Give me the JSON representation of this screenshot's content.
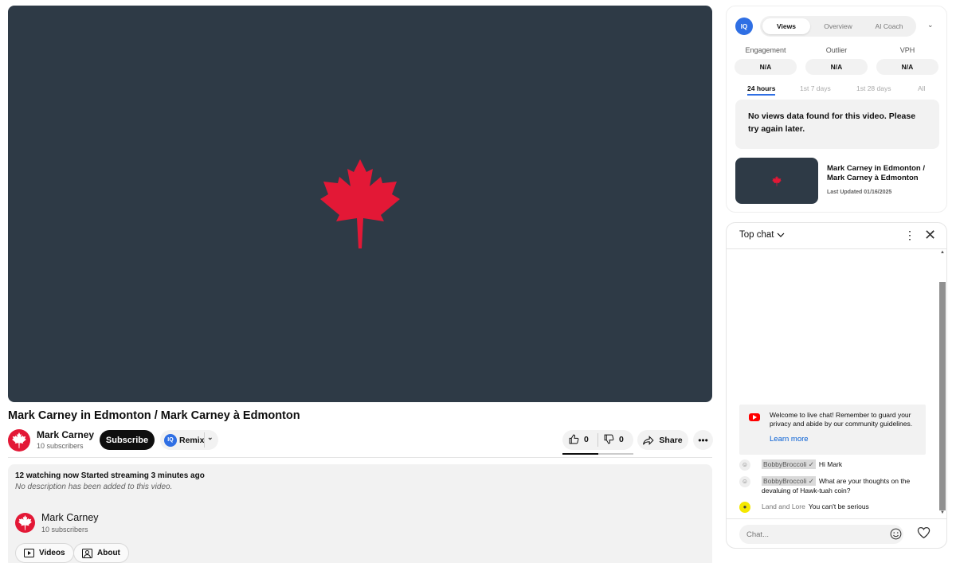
{
  "video": {
    "title": "Mark Carney in Edmonton / Mark Carney à Edmonton",
    "player_bg": "#2e3a46",
    "leaf_color": "#e31836"
  },
  "channel": {
    "name": "Mark Carney",
    "subscribers": "10 subscribers"
  },
  "actions": {
    "subscribe": "Subscribe",
    "remix": "Remix",
    "likes": "0",
    "dislikes": "0",
    "share": "Share"
  },
  "description": {
    "meta": "12 watching now  Started streaming 3 minutes ago",
    "empty": "No description has been added to this video.",
    "channel_name": "Mark Carney",
    "channel_subs": "10 subscribers",
    "videos_button": "Videos",
    "about_button": "About"
  },
  "analytics": {
    "logo": "IQ",
    "tabs": [
      "Views",
      "Overview",
      "AI Coach"
    ],
    "metrics": [
      {
        "label": "Engagement",
        "value": "N/A"
      },
      {
        "label": "Outlier",
        "value": "N/A"
      },
      {
        "label": "VPH",
        "value": "N/A"
      }
    ],
    "ranges": [
      "24 hours",
      "1st 7 days",
      "1st 28 days",
      "All"
    ],
    "no_data": "No views data found for this video. Please try again later.",
    "related_title": "Mark Carney in Edmonton / Mark Carney à Edmonton",
    "related_date": "Last Updated 01/16/2025"
  },
  "chat": {
    "title": "Top chat",
    "welcome": "Welcome to live chat! Remember to guard your privacy and abide by our community guidelines.",
    "learn_more": "Learn more",
    "messages": [
      {
        "author": "BobbyBroccoli",
        "verified_mark": "✓",
        "text": "Hi Mark"
      },
      {
        "author": "BobbyBroccoli",
        "verified_mark": "✓",
        "text": "What are your thoughts on the devaluing of Hawk-tuah coin?"
      },
      {
        "author": "Land and Lore",
        "text": "You can't be serious"
      }
    ],
    "input_placeholder": "Chat..."
  }
}
